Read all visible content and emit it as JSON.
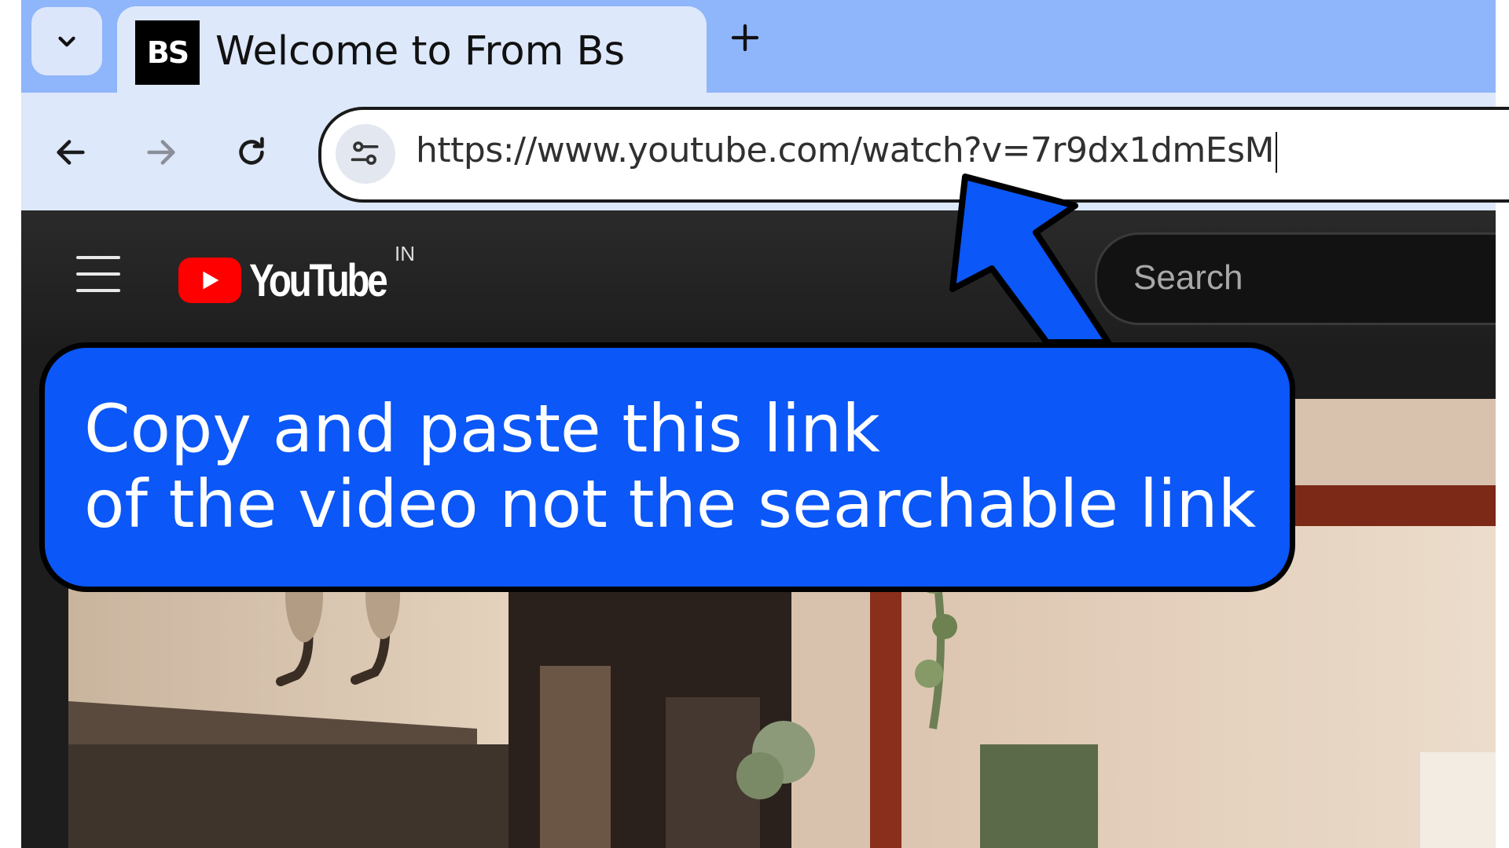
{
  "browser": {
    "tab": {
      "favicon_text": "BS",
      "title": "Welcome to From Bs"
    },
    "new_tab_symbol": "+",
    "omnibox": {
      "url": "https://www.youtube.com/watch?v=7r9dx1dmEsM"
    }
  },
  "youtube": {
    "logo_text": "YouTube",
    "country_code": "IN",
    "search_placeholder": "Search"
  },
  "annotation": {
    "line_1": "Copy and paste this link",
    "line_2": "of the video not the searchable link",
    "callout_color": "#0b57f7",
    "arrow_color": "#0b57f7"
  },
  "colors": {
    "tabstrip": "#8fb5fa",
    "toolbar": "#dde8fb",
    "youtube_red": "#ff0000",
    "youtube_bg": "#1d1d1d"
  }
}
